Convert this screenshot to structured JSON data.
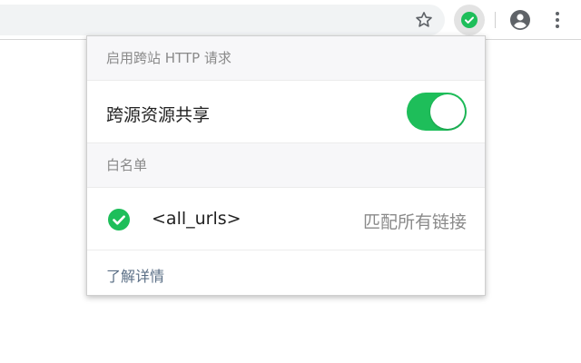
{
  "popup": {
    "section1_title": "启用跨站 HTTP 请求",
    "cors_label": "跨源资源共享",
    "cors_enabled": true,
    "section2_title": "白名单",
    "whitelist": [
      {
        "pattern": "<all_urls>",
        "description": "匹配所有链接"
      }
    ],
    "learn_more": "了解详情"
  },
  "colors": {
    "accent": "#1ebe5a",
    "header_bg": "#f7f7f9",
    "muted_text": "#8a8a8a",
    "link": "#5b6f86"
  },
  "icons": {
    "toolbar": [
      "star-icon",
      "extension-check-icon",
      "profile-icon",
      "more-vert-icon"
    ],
    "whitelist_status": "check-circle-icon"
  }
}
